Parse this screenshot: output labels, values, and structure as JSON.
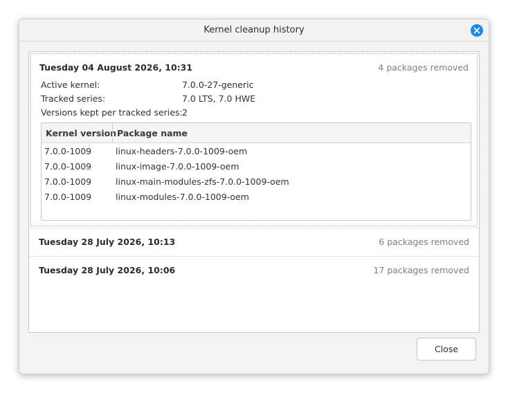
{
  "window": {
    "title": "Kernel cleanup history"
  },
  "entries": [
    {
      "date": "Tuesday 04 August 2026, 10:31",
      "count": "4 packages removed",
      "details": {
        "active_kernel_label": "Active kernel:",
        "active_kernel_value": "7.0.0-27-generic",
        "tracked_series_label": "Tracked series:",
        "tracked_series_value": "7.0 LTS, 7.0 HWE",
        "versions_kept_label": "Versions kept per tracked series:",
        "versions_kept_value": "2"
      },
      "table": {
        "headers": [
          "Kernel version",
          "Package name"
        ],
        "rows": [
          [
            "7.0.0-1009",
            "linux-headers-7.0.0-1009-oem"
          ],
          [
            "7.0.0-1009",
            "linux-image-7.0.0-1009-oem"
          ],
          [
            "7.0.0-1009",
            "linux-main-modules-zfs-7.0.0-1009-oem"
          ],
          [
            "7.0.0-1009",
            "linux-modules-7.0.0-1009-oem"
          ]
        ]
      }
    },
    {
      "date": "Tuesday 28 July 2026, 10:13",
      "count": "6 packages removed"
    },
    {
      "date": "Tuesday 28 July 2026, 10:06",
      "count": "17 packages removed"
    }
  ],
  "footer": {
    "close_label": "Close"
  },
  "colors": {
    "accent": "#1c87e6"
  }
}
